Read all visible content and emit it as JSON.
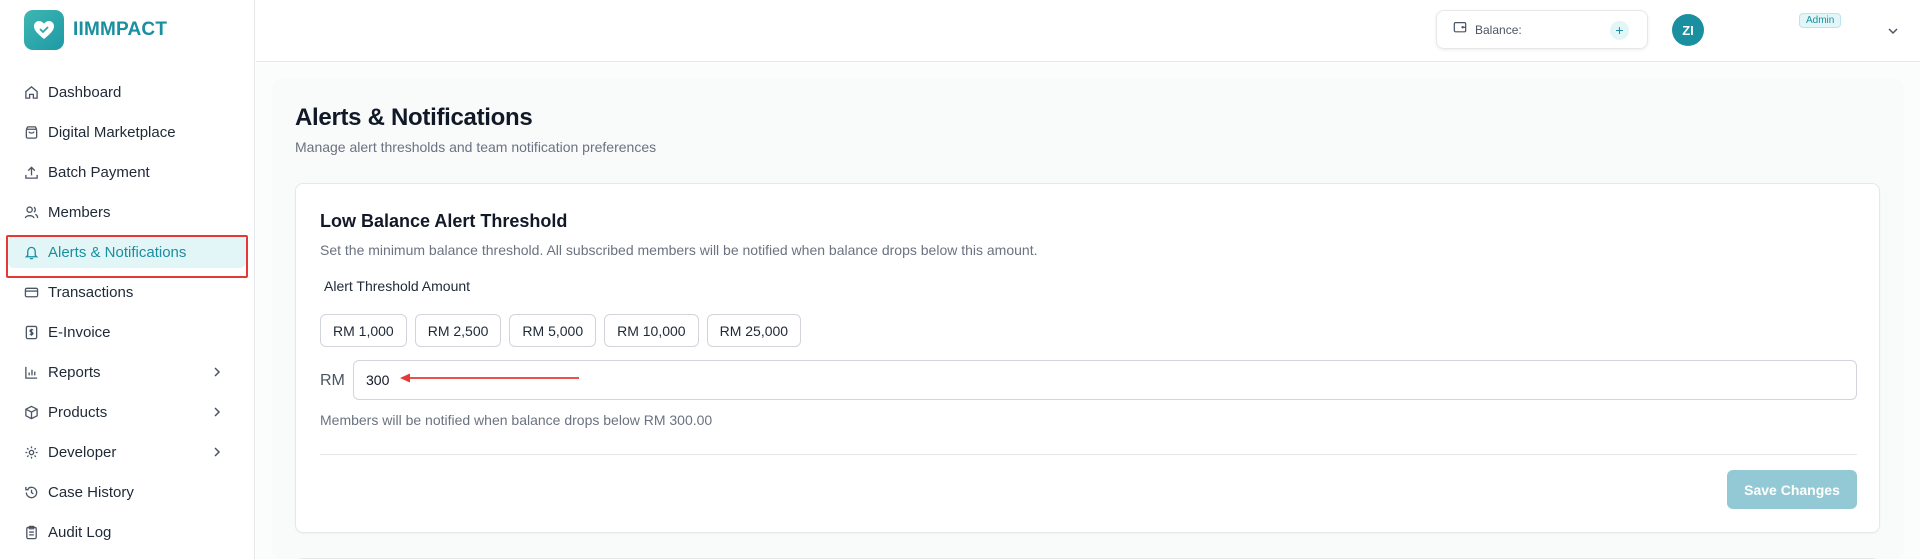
{
  "brand": {
    "name": "IIMMPACT"
  },
  "sidebar": {
    "items": [
      {
        "label": "Dashboard",
        "icon": "home-icon"
      },
      {
        "label": "Digital Marketplace",
        "icon": "shopping-bag-icon"
      },
      {
        "label": "Batch Payment",
        "icon": "upload-icon"
      },
      {
        "label": "Members",
        "icon": "users-icon"
      },
      {
        "label": "Alerts & Notifications",
        "icon": "bell-icon",
        "active": true
      },
      {
        "label": "Transactions",
        "icon": "credit-card-icon"
      },
      {
        "label": "E-Invoice",
        "icon": "invoice-icon"
      },
      {
        "label": "Reports",
        "icon": "bar-chart-icon",
        "expandable": true
      },
      {
        "label": "Products",
        "icon": "package-icon",
        "expandable": true
      },
      {
        "label": "Developer",
        "icon": "gear-icon",
        "expandable": true
      },
      {
        "label": "Case History",
        "icon": "history-icon"
      },
      {
        "label": "Audit Log",
        "icon": "clipboard-icon"
      }
    ]
  },
  "header": {
    "balance_label": "Balance:",
    "avatar_initials": "ZI",
    "role_badge": "Admin"
  },
  "page": {
    "title": "Alerts & Notifications",
    "subtitle": "Manage alert thresholds and team notification preferences"
  },
  "threshold_card": {
    "title": "Low Balance Alert Threshold",
    "description": "Set the minimum balance threshold. All subscribed members will be notified when balance drops below this amount.",
    "field_label": "Alert Threshold Amount",
    "presets": [
      "RM 1,000",
      "RM 2,500",
      "RM 5,000",
      "RM 10,000",
      "RM 25,000"
    ],
    "currency_prefix": "RM",
    "amount_value": "300",
    "helper_text": "Members will be notified when balance drops below RM 300.00",
    "save_label": "Save Changes"
  },
  "colors": {
    "accent": "#1a8fa0",
    "active_bg": "#e2f6f8",
    "save_disabled": "#93c9d5",
    "annotation_red": "#e53935"
  }
}
